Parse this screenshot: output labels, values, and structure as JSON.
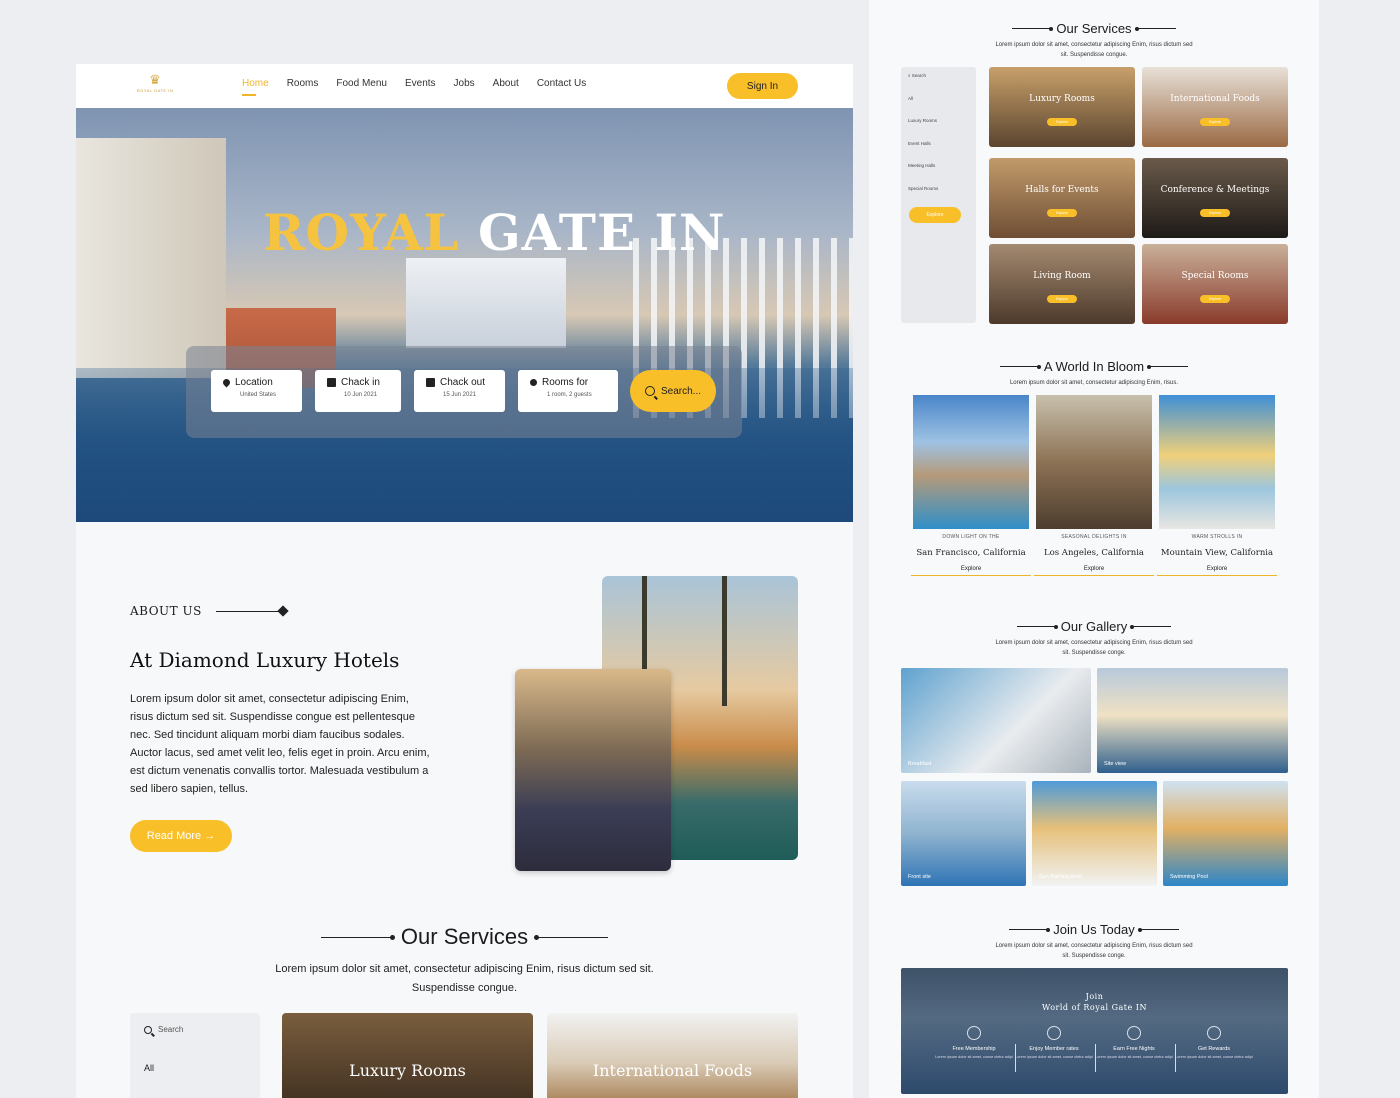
{
  "brand": {
    "logo_text": "ROYAL GATE IN"
  },
  "nav": {
    "items": [
      "Home",
      "Rooms",
      "Food Menu",
      "Events",
      "Jobs",
      "About",
      "Contact Us"
    ],
    "active": "Home",
    "signin_label": "Sign In"
  },
  "hero": {
    "title_gold": "ROYAL",
    "title_white": "GATE IN",
    "fields": [
      {
        "label": "Location",
        "value": "United States",
        "icon": "location-pin-icon"
      },
      {
        "label": "Chack in",
        "value": "10 Jun 2021",
        "icon": "calendar-icon"
      },
      {
        "label": "Chack out",
        "value": "15 Jun 2021",
        "icon": "calendar-icon"
      },
      {
        "label": "Rooms for",
        "value": "1 room, 2 guests",
        "icon": "user-icon"
      }
    ],
    "search_label": "Search..."
  },
  "about": {
    "kicker": "ABOUT US",
    "heading": "At Diamond Luxury Hotels",
    "body": "Lorem ipsum dolor sit amet, consectetur adipiscing Enim, risus dictum sed sit. Suspendisse congue est pellentesque nec. Sed tincidunt aliquam morbi diam faucibus sodales. Auctor lacus, sed amet velit leo, felis eget in proin. Arcu enim, est dictum venenatis convallis tortor. Malesuada vestibulum a sed libero sapien, tellus.",
    "read_more": "Read More"
  },
  "services": {
    "title": "Our Services",
    "subtitle": "Lorem ipsum dolor sit amet, consectetur adipiscing Enim, risus dictum sed sit. Suspendisse congue.",
    "search_placeholder": "Search",
    "filters": [
      "All",
      "Luxury Rooms",
      "Event Halls",
      "Meeting Halls",
      "Special Rooms"
    ],
    "explore_label": "Explore",
    "cards": [
      "Luxury Rooms",
      "International Foods",
      "Halls for Events",
      "Conference & Meetings",
      "Living Room",
      "Special Rooms"
    ]
  },
  "bloom": {
    "title": "A World In Bloom",
    "subtitle": "Lorem ipsum dolor sit amet, consectetur adipiscing Enim, risus.",
    "items": [
      {
        "kicker": "DOWN LIGHT ON THE",
        "city": "San Francisco, California",
        "cta": "Explore"
      },
      {
        "kicker": "SEASONAL DELIGHTS IN",
        "city": "Los Angeles, California",
        "cta": "Explore"
      },
      {
        "kicker": "WARM STROLLS IN",
        "city": "Mountain View, California",
        "cta": "Explore"
      }
    ]
  },
  "gallery": {
    "title": "Our Gallery",
    "subtitle": "Lorem ipsum dolor sit amet, consectetur adipiscing Enim, risus dictum sed sit. Suspendisse conge.",
    "items": [
      "Breakfast",
      "Site view",
      "Front site",
      "Sun Bathing Area",
      "Swimming Pool"
    ]
  },
  "join": {
    "title": "Join Us Today",
    "subtitle": "Lorem ipsum dolor sit amet, consectetur adipiscing Enim, risus dictum sed sit. Suspendisse conge.",
    "banner_line1": "Join",
    "banner_line2": "World of Royal Gate IN",
    "perks": [
      {
        "title": "Free Membership",
        "desc": "Lorem ipsum dolor sit amet, conse ctetur adipi"
      },
      {
        "title": "Enjoy Member rates",
        "desc": "Lorem ipsum dolor sit amet, conse ctetur adipi"
      },
      {
        "title": "Earn Free Nights",
        "desc": "Lorem ipsum dolor sit amet, conse ctetur adipi"
      },
      {
        "title": "Get Rewards",
        "desc": "Lorem ipsum dolor sit amet, conse ctetur adipi"
      }
    ]
  },
  "colors": {
    "accent": "#f9bf29",
    "title_gold": "#f6c341"
  }
}
